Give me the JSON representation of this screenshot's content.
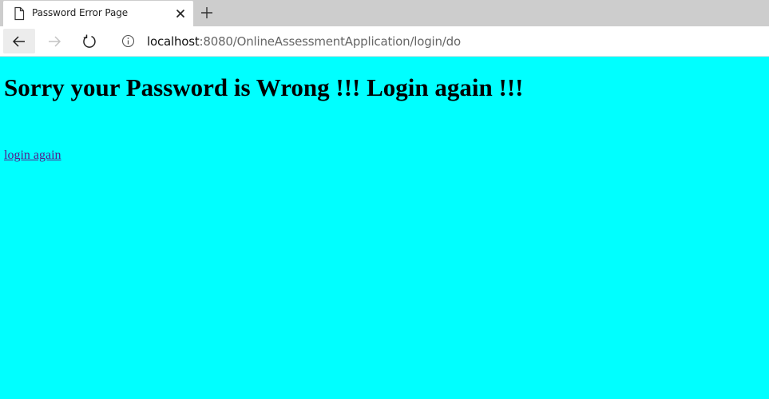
{
  "browser": {
    "tab": {
      "title": "Password Error Page",
      "icon": "page-icon"
    },
    "address": {
      "host": "localhost",
      "rest": ":8080/OnlineAssessmentApplication/login/do"
    }
  },
  "page": {
    "background": "#00ffff",
    "heading": "Sorry your Password is Wrong !!! Login again !!!",
    "link_label": "login again"
  }
}
